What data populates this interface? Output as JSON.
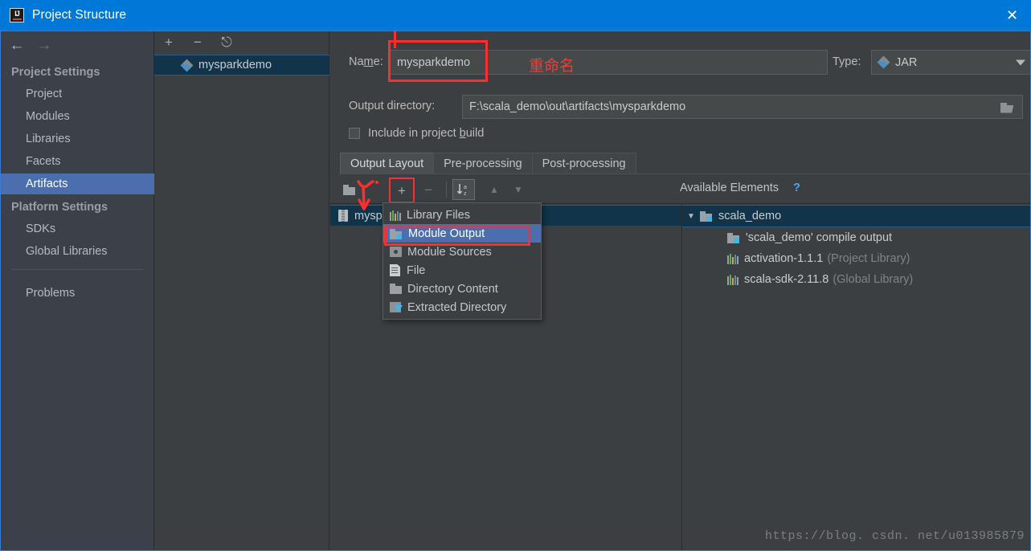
{
  "window": {
    "title": "Project Structure",
    "icon": "intellij-idea-icon",
    "close_label": "✕",
    "accent": "#0078d7"
  },
  "sidebar": {
    "back_icon": "←",
    "forward_icon": "→",
    "groups": [
      {
        "label": "Project Settings",
        "items": [
          {
            "label": "Project",
            "selected": false
          },
          {
            "label": "Modules",
            "selected": false
          },
          {
            "label": "Libraries",
            "selected": false
          },
          {
            "label": "Facets",
            "selected": false
          },
          {
            "label": "Artifacts",
            "selected": true
          }
        ]
      },
      {
        "label": "Platform Settings",
        "items": [
          {
            "label": "SDKs",
            "selected": false
          },
          {
            "label": "Global Libraries",
            "selected": false
          }
        ]
      }
    ],
    "problems": {
      "label": "Problems"
    },
    "selected_color": "#4b6eaf"
  },
  "artifacts_panel": {
    "toolbar": {
      "add_label": "+",
      "remove_label": "−",
      "copy_label": "⎋"
    },
    "items": [
      {
        "label": "mysparkdemo",
        "icon": "jar-diamond-icon",
        "selected": true
      }
    ]
  },
  "details": {
    "name": {
      "label": "Na",
      "label_underline": "m",
      "label_rest": "e:",
      "value": "mysparkdemo",
      "annotation": "重命名"
    },
    "type": {
      "label": "Type:",
      "value": "JAR",
      "icon": "jar-diamond-icon"
    },
    "output_directory": {
      "label": "Output directory:",
      "value": "F:\\scala_demo\\out\\artifacts\\mysparkdemo",
      "browse_icon": "folder-icon"
    },
    "include_in_build": {
      "label_a": "Include in project ",
      "label_underline": "b",
      "label_b": "uild",
      "checked": false
    },
    "tabs": [
      {
        "label": "Output Layout",
        "active": true
      },
      {
        "label": "Pre-processing",
        "active": false
      },
      {
        "label": "Post-processing",
        "active": false
      }
    ],
    "layout_toolbar": {
      "add_folder_icon": "add-folder-icon",
      "add_icon": "plus-icon",
      "remove_icon": "minus-icon",
      "sort_icon": "sort-az-icon",
      "move_up_icon": "▲",
      "move_down_icon": "▼"
    },
    "output_tree": [
      {
        "label": "mysp",
        "icon": "jar-icon",
        "selected": true
      }
    ],
    "available_elements": {
      "title": "Available Elements",
      "help": "?",
      "help_color": "#589df6",
      "tree": [
        {
          "label": "scala_demo",
          "icon": "module-output-icon",
          "caret": "▼",
          "selected": true,
          "depth": 0,
          "suffix": ""
        },
        {
          "label": "'scala_demo' compile output",
          "icon": "module-output-icon",
          "caret": "",
          "selected": false,
          "depth": 1,
          "suffix": ""
        },
        {
          "label": "activation-1.1.1",
          "icon": "library-icon",
          "caret": "",
          "selected": false,
          "depth": 1,
          "suffix": "(Project Library)"
        },
        {
          "label": "scala-sdk-2.11.8",
          "icon": "library-icon",
          "caret": "",
          "selected": false,
          "depth": 1,
          "suffix": "(Global Library)"
        }
      ]
    }
  },
  "popup_menu": {
    "items": [
      {
        "label": "Library Files",
        "icon": "library-icon",
        "selected": false
      },
      {
        "label": "Module Output",
        "icon": "module-output-icon",
        "selected": true
      },
      {
        "label": "Module Sources",
        "icon": "module-sources-icon",
        "selected": false
      },
      {
        "label": "File",
        "icon": "file-icon",
        "selected": false
      },
      {
        "label": "Directory Content",
        "icon": "directory-icon",
        "selected": false
      },
      {
        "label": "Extracted Directory",
        "icon": "extracted-directory-icon",
        "selected": false
      }
    ],
    "highlight_color": "#4b6eaf"
  },
  "annotations": {
    "highlight_color": "#ff2d2d",
    "name_box": "rename-field-highlight",
    "module_output_box": "module-output-highlight",
    "arrow": "red-arrow-to-add-button"
  },
  "watermark": {
    "text": "https://blog. csdn. net/u013985879"
  }
}
